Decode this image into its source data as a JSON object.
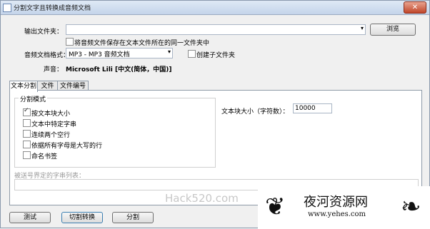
{
  "window": {
    "title": "分割文字且转换成音频文档",
    "close": "✕"
  },
  "output": {
    "label": "输出文件夹：",
    "value": "",
    "browse": "浏览"
  },
  "save_same_folder": {
    "label": "将音频文件保存在文本文件所在的同一文件夹中",
    "checked": false
  },
  "format": {
    "label": "音频文档格式：",
    "value": "MP3 - MP3 音频文档",
    "create_sub": "创建子文件夹"
  },
  "voice": {
    "label": "声音：",
    "value": "Microsoft Lili [中文(简体，中国)]"
  },
  "tabs": [
    {
      "label": "文本分割"
    },
    {
      "label": "文件"
    },
    {
      "label": "文件编号"
    }
  ],
  "split_mode": {
    "title": "分割模式",
    "options": [
      {
        "label": "按文本块大小",
        "checked": true
      },
      {
        "label": "文本中特定字串",
        "checked": false
      },
      {
        "label": "连续两个空行",
        "checked": false
      },
      {
        "label": "依据所有字母是大写的行",
        "checked": false
      },
      {
        "label": "命名书签",
        "checked": false
      }
    ]
  },
  "block_size": {
    "label": "文本块大小（字符数）：",
    "value": "10000"
  },
  "separator": {
    "label": "被送号界定的字串列表：",
    "value": ""
  },
  "buttons": {
    "test": "测试",
    "split_convert": "切割转换",
    "split": "分割"
  },
  "watermark": {
    "hack": "Hack520.com",
    "site": "夜河资源网",
    "url": "www.yehes.com"
  }
}
